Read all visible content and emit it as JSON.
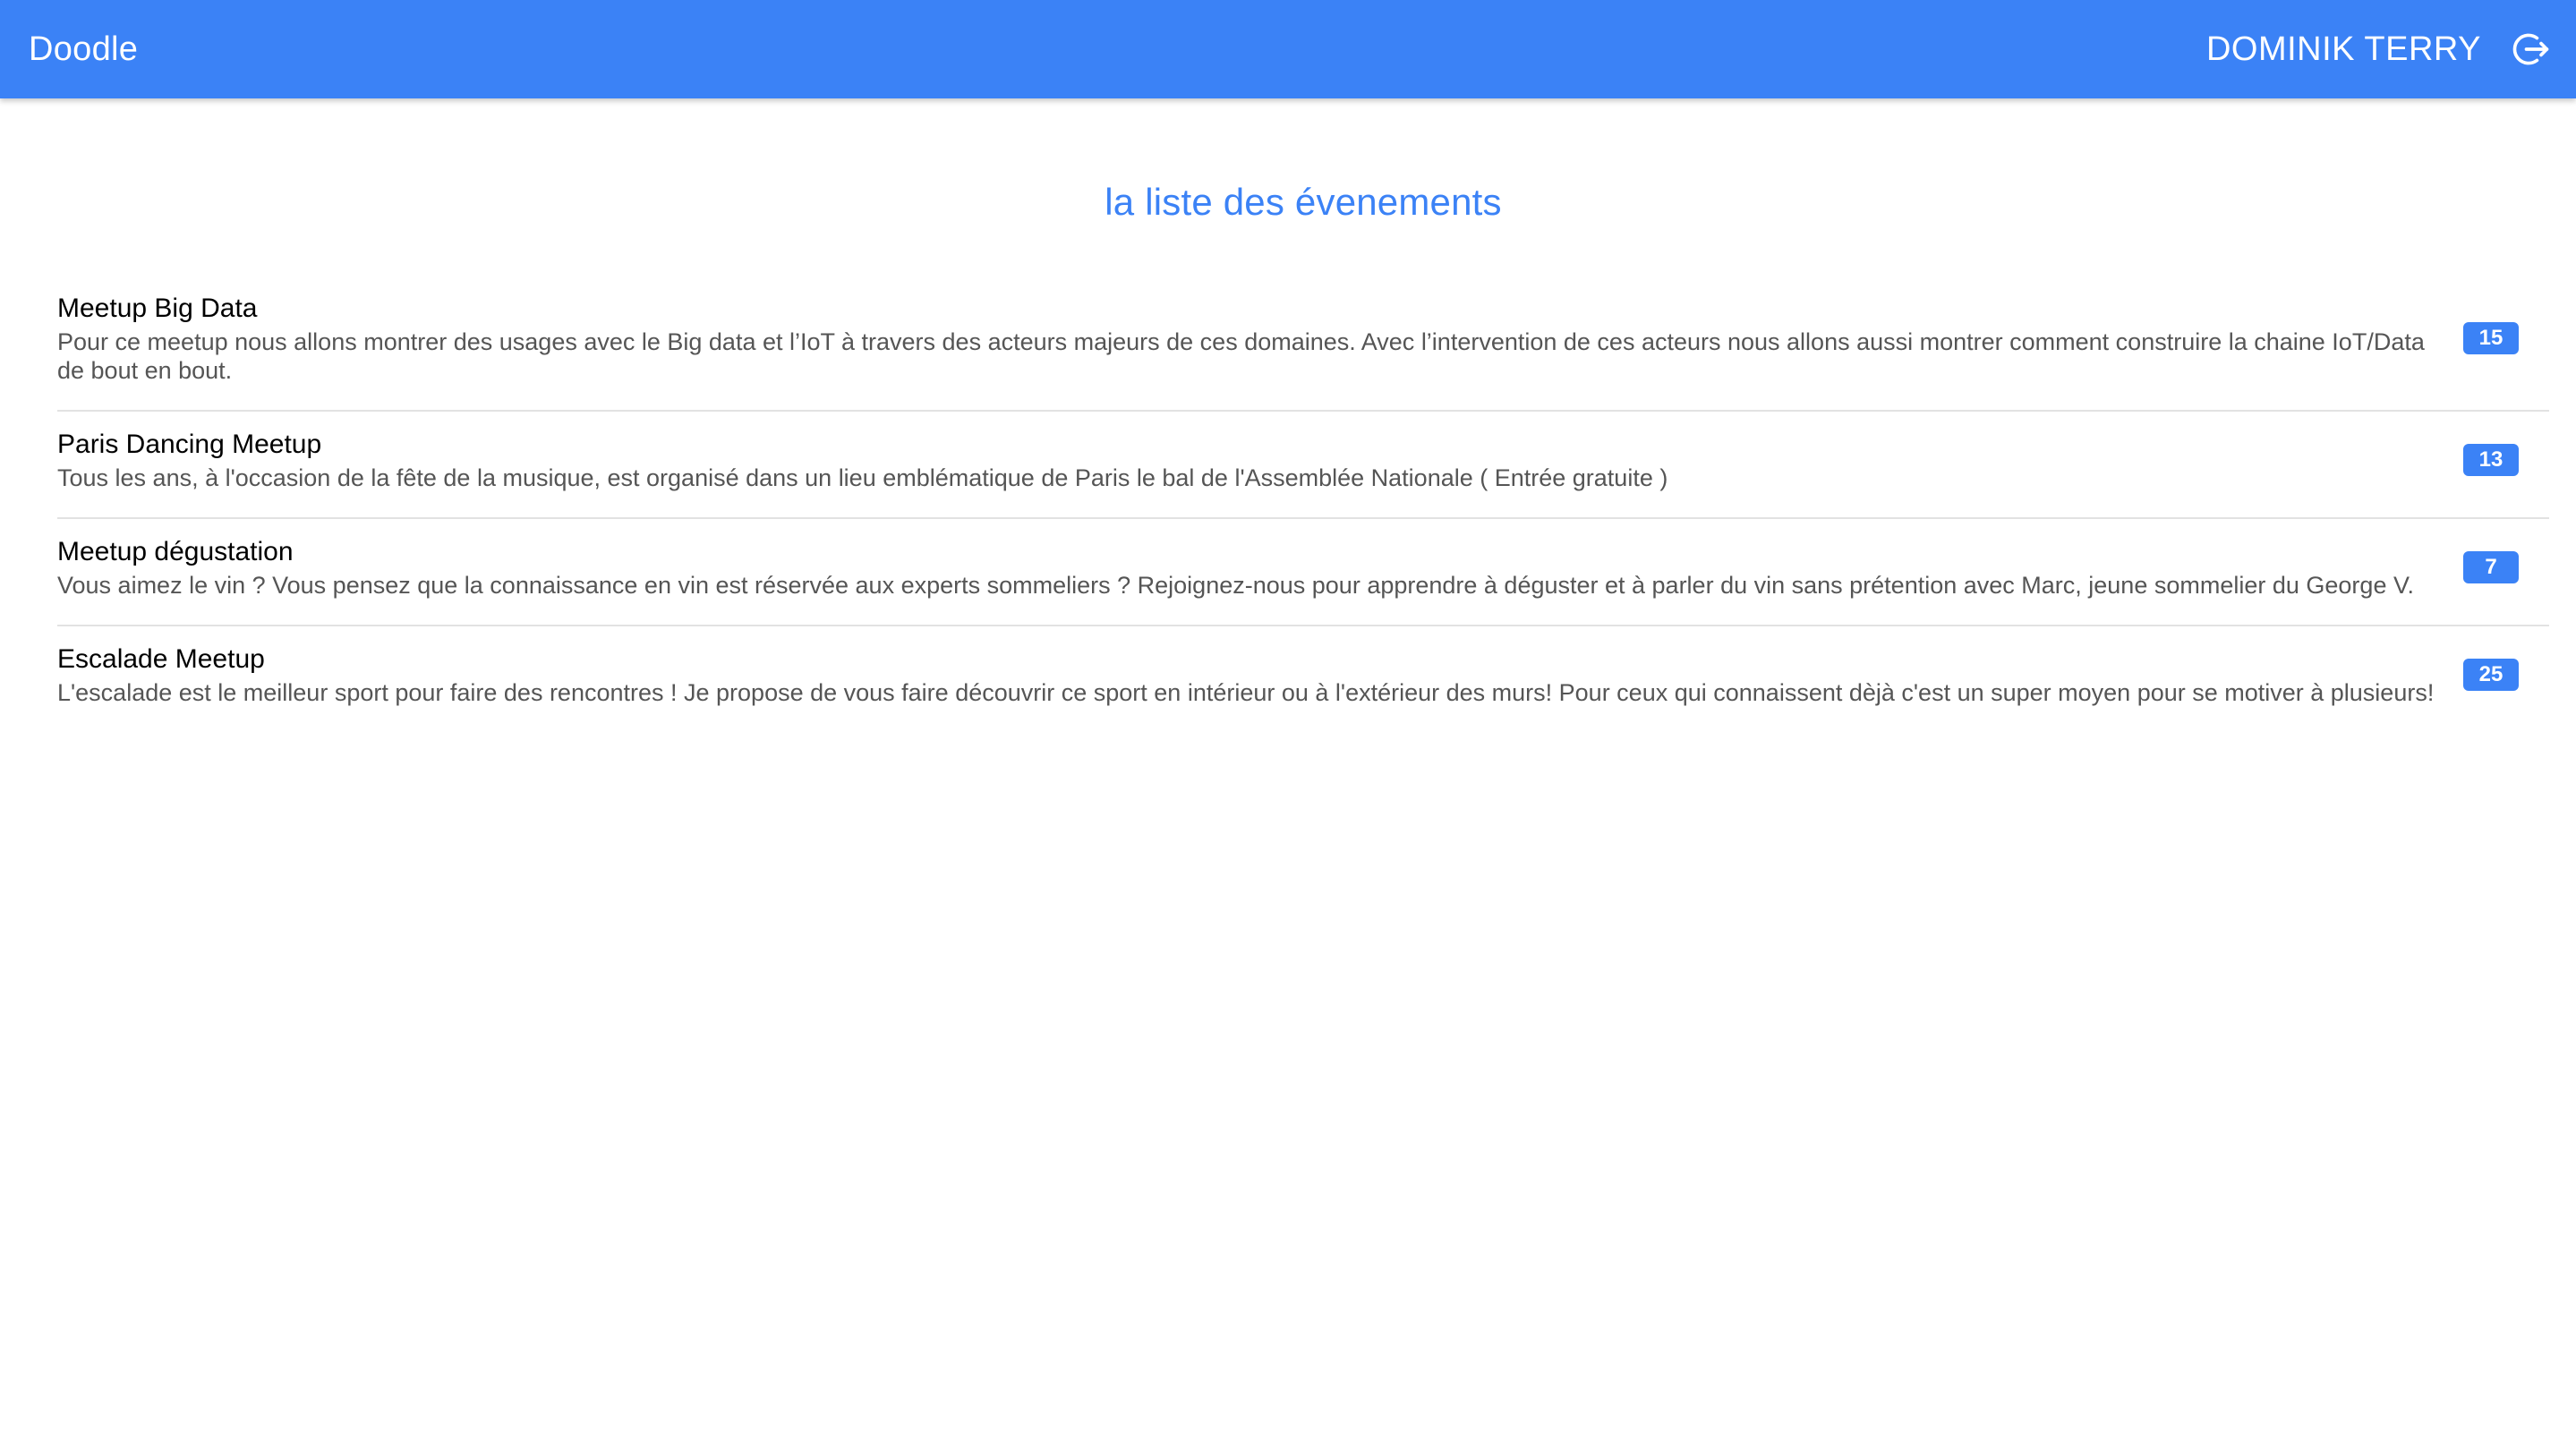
{
  "appbar": {
    "brand": "Doodle",
    "user_name": "DOMINIK TERRY",
    "logout_icon": "logout-icon"
  },
  "main": {
    "title": "la liste des évenements",
    "events": [
      {
        "title": "Meetup Big Data",
        "description": "Pour ce meetup nous allons montrer des usages avec le Big data et l’IoT à travers des acteurs majeurs de ces domaines. Avec l’intervention de ces acteurs nous allons aussi montrer comment construire la chaine IoT/Data de bout en bout.",
        "count": "15"
      },
      {
        "title": "Paris Dancing Meetup",
        "description": "Tous les ans, à l'occasion de la fête de la musique, est organisé dans un lieu emblématique de Paris le bal de l'Assemblée Nationale ( Entrée gratuite )",
        "count": "13"
      },
      {
        "title": "Meetup dégustation",
        "description": "Vous aimez le vin ? Vous pensez que la connaissance en vin est réservée aux experts sommeliers ? Rejoignez-nous pour apprendre à déguster et à parler du vin sans prétention avec Marc, jeune sommelier du George V.",
        "count": "7"
      },
      {
        "title": "Escalade Meetup",
        "description": "L'escalade est le meilleur sport pour faire des rencontres ! Je propose de vous faire découvrir ce sport en intérieur ou à l'extérieur des murs! Pour ceux qui connaissent dèjà c'est un super moyen pour se motiver à plusieurs!",
        "count": "25"
      }
    ]
  },
  "colors": {
    "primary": "#3b82f6",
    "text": "#000000",
    "secondary_text": "#555555",
    "divider": "#e2e2e2"
  }
}
